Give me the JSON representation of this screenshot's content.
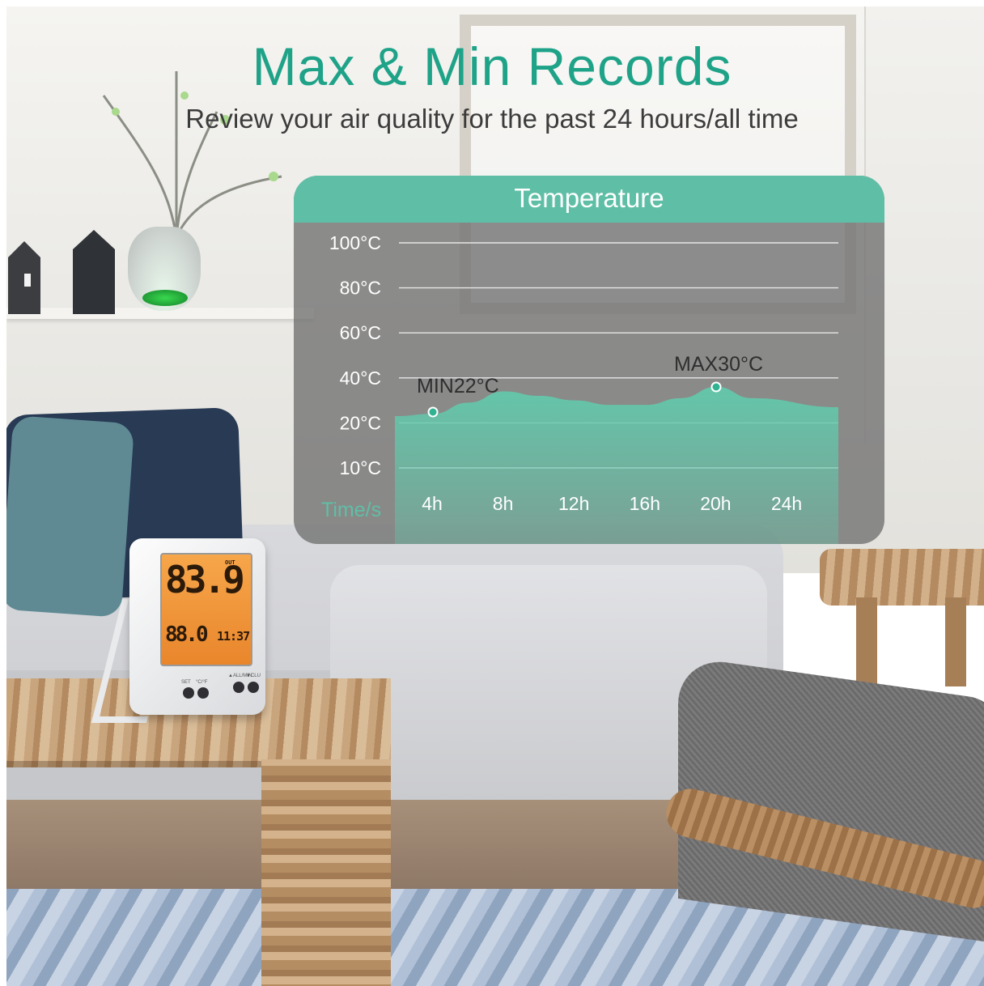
{
  "header": {
    "title": "Max & Min Records",
    "subtitle": "Review your air quality for the past 24 hours/all time"
  },
  "device": {
    "display_main": "83.9",
    "display_out_label": "OUT",
    "display_secondary": "88.0",
    "display_time": "11:37",
    "button_labels": [
      "SET",
      "°C/°F",
      "▲ALL/MIN",
      "▼CLU"
    ]
  },
  "colors": {
    "accent": "#1fa388",
    "header_band": "#5fbfa6",
    "area_fill": "#62c9ab",
    "panel_bg": "#707070"
  },
  "chart_data": {
    "type": "area",
    "title": "Temperature",
    "xlabel": "Time/s",
    "ylabel": "",
    "x_ticks": [
      "4h",
      "8h",
      "12h",
      "16h",
      "20h",
      "24h"
    ],
    "y_ticks": [
      "100°C",
      "80°C",
      "60°C",
      "40°C",
      "20°C",
      "10°C"
    ],
    "y_tick_values": [
      100,
      80,
      60,
      40,
      20,
      10
    ],
    "grid": true,
    "x": [
      3,
      4,
      6,
      8,
      10,
      12,
      14,
      16,
      18,
      20,
      22,
      24
    ],
    "values": [
      23,
      24,
      29,
      34,
      32,
      30,
      28,
      28,
      31,
      36,
      31,
      27
    ],
    "annotations": [
      {
        "label": "MIN22°C",
        "x": 4,
        "y": 22
      },
      {
        "label": "MAX30°C",
        "x": 20,
        "y": 30
      }
    ]
  }
}
